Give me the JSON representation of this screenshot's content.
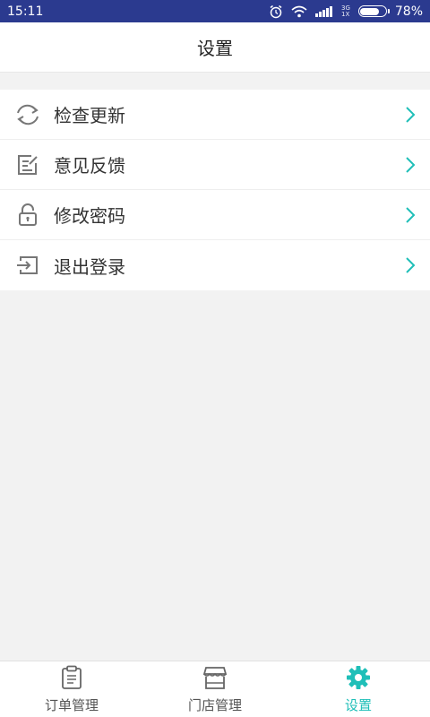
{
  "status_bar": {
    "time": "15:11",
    "network_top": "3G",
    "network_bottom": "1X",
    "battery_percent": "78%",
    "battery_level": 0.78,
    "icons": [
      "alarm-icon",
      "wifi-icon",
      "signal-icon",
      "battery-icon"
    ]
  },
  "header": {
    "title": "设置"
  },
  "menu": {
    "items": [
      {
        "label": "检查更新",
        "icon": "refresh-icon"
      },
      {
        "label": "意见反馈",
        "icon": "feedback-edit-icon"
      },
      {
        "label": "修改密码",
        "icon": "lock-icon"
      },
      {
        "label": "退出登录",
        "icon": "logout-icon"
      }
    ],
    "chevron_icon": "chevron-right-icon"
  },
  "bottom_nav": {
    "items": [
      {
        "label": "订单管理",
        "icon": "clipboard-icon",
        "active": false
      },
      {
        "label": "门店管理",
        "icon": "store-icon",
        "active": false
      },
      {
        "label": "设置",
        "icon": "gear-icon",
        "active": true
      }
    ]
  },
  "colors": {
    "status_bar_bg": "#2b3a8f",
    "accent": "#1fbfb8",
    "page_bg": "#f2f2f2",
    "icon_gray": "#777777"
  }
}
